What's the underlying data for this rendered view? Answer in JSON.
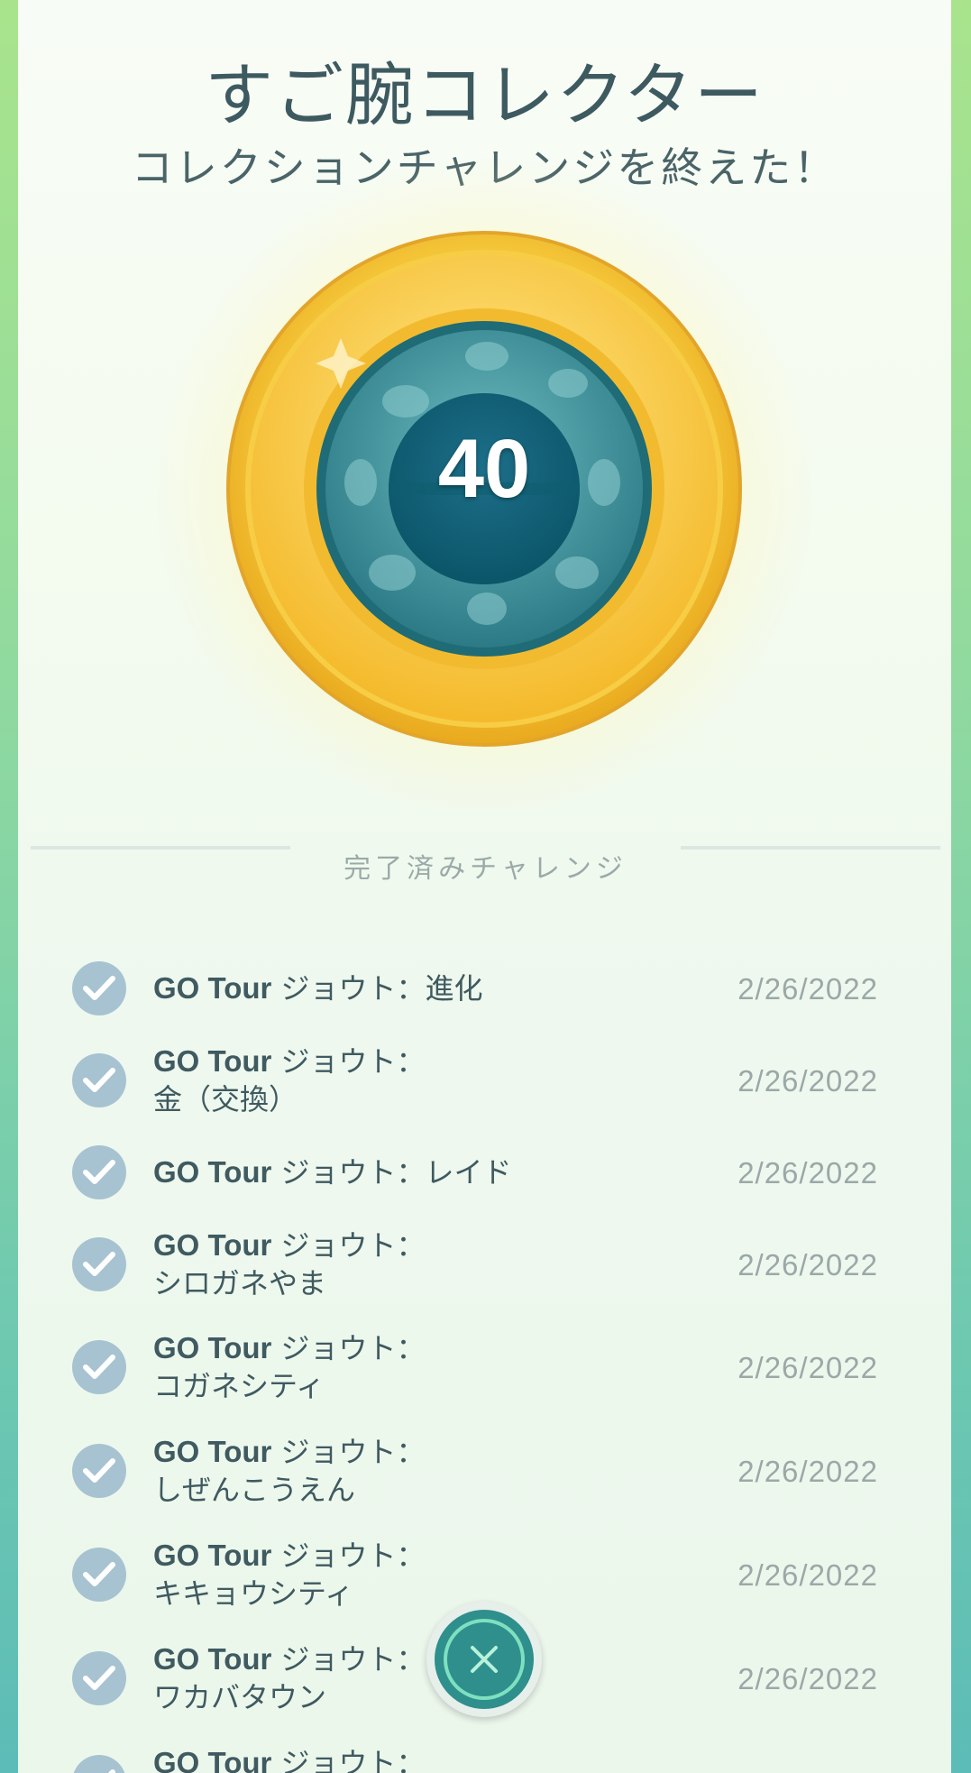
{
  "header": {
    "title": "すご腕コレクター",
    "subtitle": "コレクションチャレンジを終えた！"
  },
  "badge": {
    "count": "40",
    "tier": "gold"
  },
  "section": {
    "label": "完了済みチャレンジ"
  },
  "challenges": [
    {
      "prefix": "GO Tour",
      "line1": " ジョウト：進化",
      "line2": "",
      "date": "2/26/2022"
    },
    {
      "prefix": "GO Tour",
      "line1": " ジョウト：",
      "line2": "金（交換）",
      "date": "2/26/2022"
    },
    {
      "prefix": "GO Tour",
      "line1": " ジョウト：レイド",
      "line2": "",
      "date": "2/26/2022"
    },
    {
      "prefix": "GO Tour",
      "line1": " ジョウト：",
      "line2": "シロガネやま",
      "date": "2/26/2022"
    },
    {
      "prefix": "GO Tour",
      "line1": " ジョウト：",
      "line2": "コガネシティ",
      "date": "2/26/2022"
    },
    {
      "prefix": "GO Tour",
      "line1": " ジョウト：",
      "line2": "しぜんこうえん",
      "date": "2/26/2022"
    },
    {
      "prefix": "GO Tour",
      "line1": " ジョウト：",
      "line2": "キキョウシティ",
      "date": "2/26/2022"
    },
    {
      "prefix": "GO Tour",
      "line1": " ジョウト：",
      "line2": "ワカバタウン",
      "date": "2/26/2022"
    },
    {
      "prefix": "GO Tour",
      "line1": " ジョウト：",
      "line2": "",
      "date": ""
    }
  ],
  "colors": {
    "accent": "#2e8f8c",
    "check": "#a7c3d1",
    "gold": "#f5c52a"
  },
  "icons": {
    "close": "close-icon",
    "check": "checkmark-icon"
  }
}
